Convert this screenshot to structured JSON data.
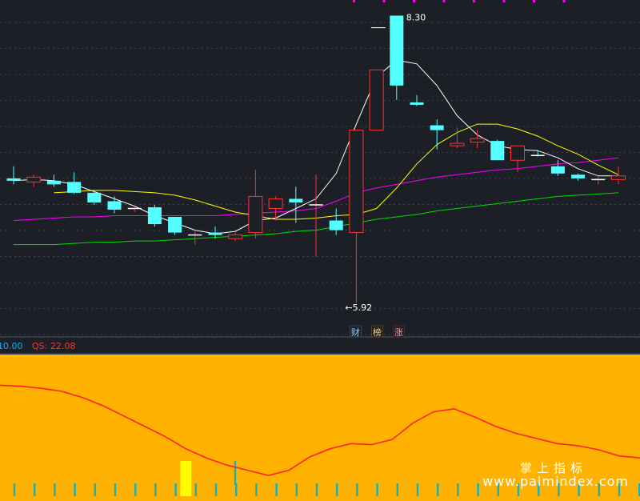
{
  "chart_data": [
    {
      "type": "candlestick",
      "panel": "main",
      "colors": {
        "up": "#ff3232",
        "down": "#54ffff",
        "ma5": "#ffffff",
        "ma10": "#ffff00",
        "ma20": "#ff00ff",
        "ma60": "#00dd00"
      },
      "price_range": [
        5.8,
        8.35
      ],
      "candles": [
        {
          "o": 6.95,
          "h": 7.05,
          "l": 6.9,
          "c": 6.93
        },
        {
          "o": 6.92,
          "h": 6.98,
          "l": 6.88,
          "c": 6.96
        },
        {
          "o": 6.93,
          "h": 6.98,
          "l": 6.88,
          "c": 6.9
        },
        {
          "o": 6.92,
          "h": 7.0,
          "l": 6.82,
          "c": 6.83
        },
        {
          "o": 6.83,
          "h": 6.85,
          "l": 6.73,
          "c": 6.75
        },
        {
          "o": 6.76,
          "h": 6.8,
          "l": 6.66,
          "c": 6.69
        },
        {
          "o": 6.7,
          "h": 6.72,
          "l": 6.67,
          "c": 6.7
        },
        {
          "o": 6.71,
          "h": 6.73,
          "l": 6.55,
          "c": 6.57
        },
        {
          "o": 6.63,
          "h": 6.63,
          "l": 6.48,
          "c": 6.5
        },
        {
          "o": 6.47,
          "h": 6.52,
          "l": 6.4,
          "c": 6.48
        },
        {
          "o": 6.5,
          "h": 6.55,
          "l": 6.45,
          "c": 6.48
        },
        {
          "o": 6.45,
          "h": 6.5,
          "l": 6.43,
          "c": 6.48
        },
        {
          "o": 6.5,
          "h": 7.02,
          "l": 6.45,
          "c": 6.8
        },
        {
          "o": 6.7,
          "h": 6.8,
          "l": 6.6,
          "c": 6.78
        },
        {
          "o": 6.78,
          "h": 6.88,
          "l": 6.58,
          "c": 6.75
        },
        {
          "o": 6.73,
          "h": 6.98,
          "l": 6.3,
          "c": 6.73
        },
        {
          "o": 6.6,
          "h": 6.7,
          "l": 6.48,
          "c": 6.52
        },
        {
          "o": 6.5,
          "h": 7.35,
          "l": 5.92,
          "c": 7.35
        },
        {
          "o": 7.35,
          "h": 7.85,
          "l": 7.35,
          "c": 7.85
        },
        {
          "o": 8.3,
          "h": 8.3,
          "l": 7.6,
          "c": 7.72
        },
        {
          "o": 7.58,
          "h": 7.64,
          "l": 7.55,
          "c": 7.56
        },
        {
          "o": 7.39,
          "h": 7.44,
          "l": 7.19,
          "c": 7.35
        },
        {
          "o": 7.22,
          "h": 7.37,
          "l": 7.2,
          "c": 7.24
        },
        {
          "o": 7.25,
          "h": 7.35,
          "l": 7.2,
          "c": 7.28
        },
        {
          "o": 7.26,
          "h": 7.27,
          "l": 7.1,
          "c": 7.1
        },
        {
          "o": 7.1,
          "h": 7.22,
          "l": 7.0,
          "c": 7.22
        },
        {
          "o": 7.14,
          "h": 7.18,
          "l": 7.13,
          "c": 7.13
        },
        {
          "o": 7.05,
          "h": 7.1,
          "l": 6.97,
          "c": 6.99
        },
        {
          "o": 6.98,
          "h": 6.99,
          "l": 6.93,
          "c": 6.95
        },
        {
          "o": 6.94,
          "h": 6.97,
          "l": 6.9,
          "c": 6.94
        },
        {
          "o": 6.94,
          "h": 7.05,
          "l": 6.9,
          "c": 6.97
        }
      ],
      "ma5": [
        6.93,
        6.94,
        6.93,
        6.9,
        6.84,
        6.78,
        6.72,
        6.64,
        6.58,
        6.52,
        6.49,
        6.51,
        6.6,
        6.62,
        6.7,
        6.78,
        6.99,
        7.4,
        7.79,
        7.93,
        7.9,
        7.72,
        7.47,
        7.31,
        7.22,
        7.19,
        7.18,
        7.12,
        7.03,
        6.97,
        6.97
      ],
      "ma10": [
        6.83,
        6.84,
        6.85,
        6.85,
        6.84,
        6.83,
        6.81,
        6.77,
        6.72,
        6.67,
        6.64,
        6.61,
        6.61,
        6.62,
        6.64,
        6.65,
        6.7,
        6.87,
        7.07,
        7.23,
        7.33,
        7.4,
        7.4,
        7.36,
        7.3,
        7.22,
        7.15,
        7.06,
        6.98
      ],
      "ma20": [
        6.6,
        6.61,
        6.62,
        6.63,
        6.63,
        6.64,
        6.64,
        6.64,
        6.64,
        6.64,
        6.64,
        6.65,
        6.66,
        6.67,
        6.68,
        6.7,
        6.76,
        6.83,
        6.87,
        6.9,
        6.93,
        6.96,
        6.98,
        7.0,
        7.02,
        7.03,
        7.05,
        7.07,
        7.08,
        7.1,
        7.12
      ],
      "ma60": [
        6.4,
        6.4,
        6.4,
        6.41,
        6.42,
        6.42,
        6.43,
        6.43,
        6.44,
        6.45,
        6.46,
        6.47,
        6.48,
        6.49,
        6.51,
        6.52,
        6.55,
        6.58,
        6.61,
        6.63,
        6.65,
        6.68,
        6.7,
        6.72,
        6.74,
        6.76,
        6.78,
        6.8,
        6.81,
        6.82,
        6.83
      ],
      "labels": {
        "high": "8.30",
        "low": "5.92"
      },
      "badges": [
        "财",
        "榜",
        "涨"
      ]
    },
    {
      "type": "line",
      "panel": "indicator",
      "legend": [
        {
          "text": "10.00",
          "color": "#00b4ff"
        },
        {
          "text": "QS: 22.08",
          "color": "#ff3232"
        }
      ],
      "y_range": [
        0,
        100
      ],
      "series": [
        {
          "name": "QS",
          "color": "#ff2020",
          "values": [
            88,
            87,
            85,
            82,
            76,
            68,
            58,
            48,
            38,
            26,
            17,
            10,
            5,
            0,
            5,
            18,
            26,
            31,
            30,
            35,
            51,
            62,
            65,
            57,
            48,
            41,
            36,
            31,
            29,
            25,
            19,
            17
          ]
        }
      ],
      "background": "#ffb300",
      "highlight_bar_index": 9,
      "highlight_color": "#ffff00",
      "tick_color": "#20b2aa"
    }
  ],
  "watermark": {
    "cn": "掌上指标",
    "url": "www.palmindex.com"
  }
}
